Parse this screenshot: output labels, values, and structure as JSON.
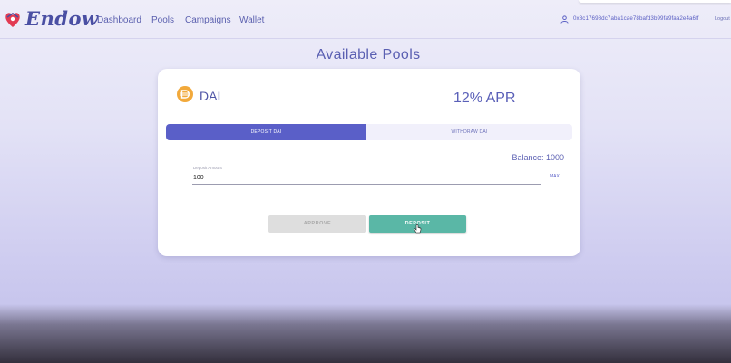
{
  "header": {
    "brand": "Endow",
    "nav": [
      "Dashboard",
      "Pools",
      "Campaigns",
      "Wallet"
    ],
    "account_address": "0x8c17698dc7aba1cae78bafd3b99fa9faa2e4a6ff",
    "logout_label": "Logout"
  },
  "page": {
    "title": "Available Pools"
  },
  "pool": {
    "token": "DAI",
    "apr": "12% APR",
    "tabs": {
      "deposit": "DEPOSIT DAI",
      "withdraw": "WITHDRAW DAI"
    },
    "active_tab": "deposit",
    "balance": "Balance: 1000",
    "deposit_field": {
      "label": "Deposit Amount",
      "value": "100"
    },
    "max_label": "MAX",
    "approve_label": "APPROVE",
    "deposit_label": "DEPOSIT"
  },
  "colors": {
    "primary": "#5a5fc8",
    "deposit_button": "#5ab7a6",
    "token_icon": "#f2a93b"
  }
}
